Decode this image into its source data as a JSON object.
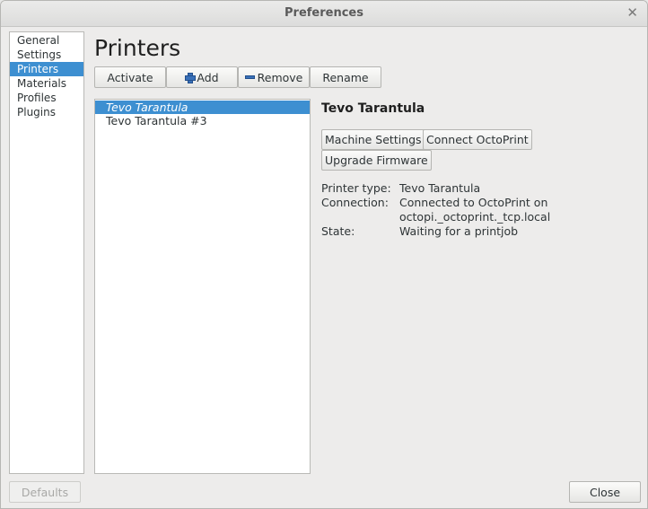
{
  "window": {
    "title": "Preferences"
  },
  "sidebar": {
    "items": [
      {
        "label": "General"
      },
      {
        "label": "Settings"
      },
      {
        "label": "Printers",
        "selected": true
      },
      {
        "label": "Materials"
      },
      {
        "label": "Profiles"
      },
      {
        "label": "Plugins"
      }
    ]
  },
  "page": {
    "title": "Printers"
  },
  "toolbar": {
    "activate_label": "Activate",
    "add_label": "Add",
    "remove_label": "Remove",
    "rename_label": "Rename"
  },
  "printers": {
    "items": [
      {
        "name": "Tevo Tarantula",
        "selected": true
      },
      {
        "name": "Tevo Tarantula #3",
        "selected": false
      }
    ]
  },
  "detail": {
    "title": "Tevo Tarantula",
    "machine_settings_label": "Machine Settings",
    "connect_octoprint_label": "Connect OctoPrint",
    "upgrade_firmware_label": "Upgrade Firmware",
    "printer_type_label": "Printer type:",
    "printer_type_value": "Tevo Tarantula",
    "connection_label": "Connection:",
    "connection_value_line1": "Connected to OctoPrint on",
    "connection_value_line2": "octopi._octoprint._tcp.local",
    "state_label": "State:",
    "state_value": "Waiting for a printjob"
  },
  "footer": {
    "defaults_label": "Defaults",
    "close_label": "Close"
  },
  "colors": {
    "selection": "#3d8fd1",
    "window_bg": "#edeceb"
  }
}
